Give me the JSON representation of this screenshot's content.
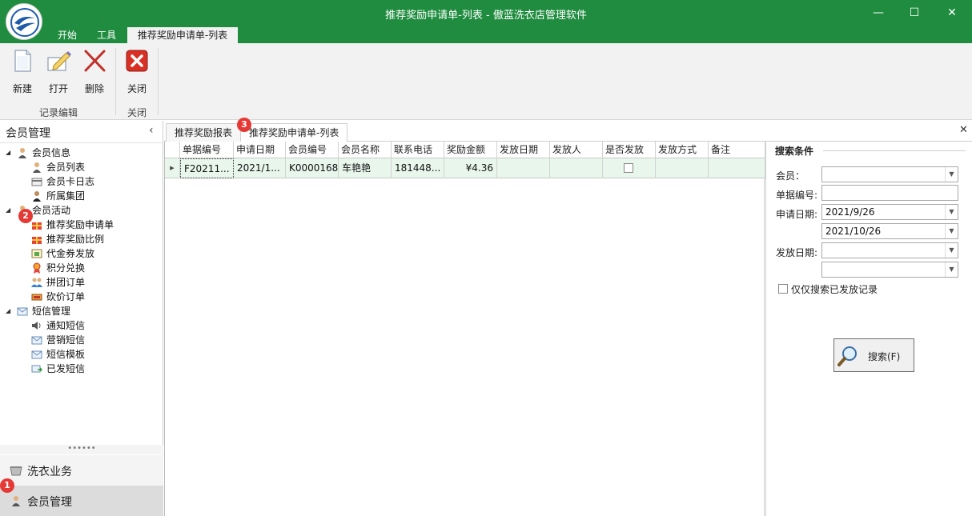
{
  "window": {
    "title": "推荐奖励申请单-列表 - 傲蓝洗衣店管理软件",
    "min_label": "—",
    "max_label": "☐",
    "close_label": "✕",
    "brand_color": "#1f8c3f"
  },
  "ribbon": {
    "tabs": [
      "开始",
      "工具",
      "推荐奖励申请单-列表"
    ],
    "buttons": {
      "new": "新建",
      "open": "打开",
      "delete": "删除",
      "close": "关闭"
    },
    "groups": {
      "edit": "记录编辑",
      "close": "关闭"
    }
  },
  "left_panel": {
    "title": "会员管理",
    "collapse_icon": "‹",
    "tree": [
      {
        "label": "会员信息",
        "icon": "member-icon",
        "expand": "◢"
      },
      {
        "label": "会员列表",
        "icon": "member-icon"
      },
      {
        "label": "会员卡日志",
        "icon": "card-icon"
      },
      {
        "label": "所属集团",
        "icon": "group-icon"
      },
      {
        "label": "会员活动",
        "icon": "member-icon",
        "expand": "◢"
      },
      {
        "label": "推荐奖励申请单",
        "icon": "gift-icon"
      },
      {
        "label": "推荐奖励比例",
        "icon": "gift-icon"
      },
      {
        "label": "代金券发放",
        "icon": "voucher-icon"
      },
      {
        "label": "积分兑换",
        "icon": "medal-icon"
      },
      {
        "label": "拼团订单",
        "icon": "team-icon"
      },
      {
        "label": "砍价订单",
        "icon": "ticket-icon"
      },
      {
        "label": "短信管理",
        "icon": "mail-icon",
        "expand": "◢"
      },
      {
        "label": "通知短信",
        "icon": "speaker-icon"
      },
      {
        "label": "营销短信",
        "icon": "mail-icon"
      },
      {
        "label": "短信模板",
        "icon": "mail-icon"
      },
      {
        "label": "已发短信",
        "icon": "sent-mail-icon"
      }
    ],
    "splitter": "••••••",
    "nav": [
      "洗衣业务",
      "会员管理"
    ]
  },
  "badges": [
    "1",
    "2",
    "3"
  ],
  "doc_tabs": [
    "推荐奖励报表",
    "推荐奖励申请单-列表"
  ],
  "doc_close": "✕",
  "grid": {
    "columns": [
      "单据编号",
      "申请日期",
      "会员编号",
      "会员名称",
      "联系电话",
      "奖励金额",
      "发放日期",
      "发放人",
      "是否发放",
      "发放方式",
      "备注"
    ],
    "row_indicator": "▶",
    "rows": [
      {
        "doc_no": "F20211...",
        "apply_date": "2021/1...",
        "member_no": "K0000168",
        "member_name": "车艳艳",
        "phone": "181448...",
        "amount": "¥4.36",
        "issue_date": "",
        "issuer": "",
        "issued": false,
        "method": "",
        "remark": ""
      }
    ],
    "row_color": "#e8f6ec"
  },
  "search": {
    "title": "搜索条件",
    "member_label": "会员：",
    "member_value": "",
    "doc_no_label": "单据编号:",
    "doc_no_value": "",
    "apply_date_label": "申请日期:",
    "apply_date_from": "2021/9/26",
    "apply_date_to": "2021/10/26",
    "issue_date_label": "发放日期:",
    "issue_date_from": "",
    "issue_date_to": "",
    "dropdown_icon": "▼",
    "only_issued_label": "仅仅搜索已发放记录",
    "only_issued_checked": false,
    "search_button": "搜索(F)"
  }
}
